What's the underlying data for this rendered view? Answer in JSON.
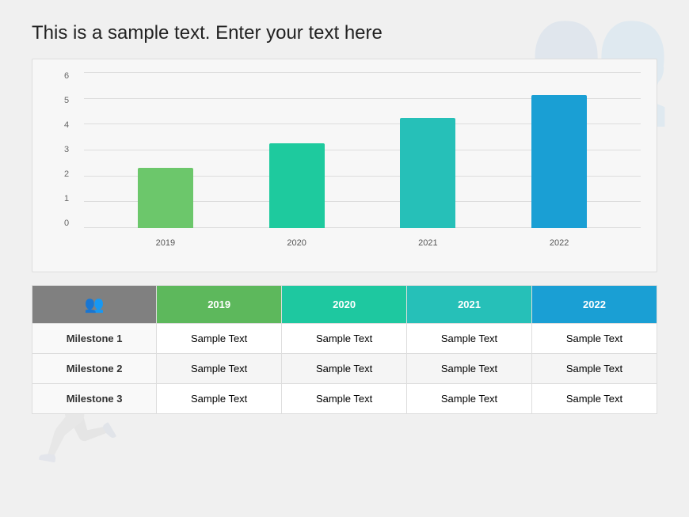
{
  "page": {
    "title": "This is a sample text. Enter your text here"
  },
  "watermarks": {
    "icon1": "👥",
    "icon2": "🏃"
  },
  "chart": {
    "y_labels": [
      "0",
      "1",
      "2",
      "3",
      "4",
      "5",
      "6"
    ],
    "bars": [
      {
        "year": "2019",
        "value": 2.5,
        "color": "#6cc76b",
        "height_pct": 41
      },
      {
        "year": "2020",
        "value": 3.5,
        "color": "#1eca9e",
        "height_pct": 58
      },
      {
        "year": "2021",
        "value": 4.5,
        "color": "#26c0b8",
        "height_pct": 75
      },
      {
        "year": "2022",
        "value": 5.5,
        "color": "#1a9fd4",
        "height_pct": 91
      }
    ]
  },
  "table": {
    "header_icon": "👥",
    "columns": [
      "",
      "2019",
      "2020",
      "2021",
      "2022"
    ],
    "rows": [
      {
        "label": "Milestone 1",
        "cells": [
          "Sample Text",
          "Sample Text",
          "Sample Text",
          "Sample Text"
        ]
      },
      {
        "label": "Milestone 2",
        "cells": [
          "Sample Text",
          "Sample Text",
          "Sample Text",
          "Sample Text"
        ]
      },
      {
        "label": "Milestone 3",
        "cells": [
          "Sample Text",
          "Sample Text",
          "Sample Text",
          "Sample Text"
        ]
      }
    ]
  }
}
